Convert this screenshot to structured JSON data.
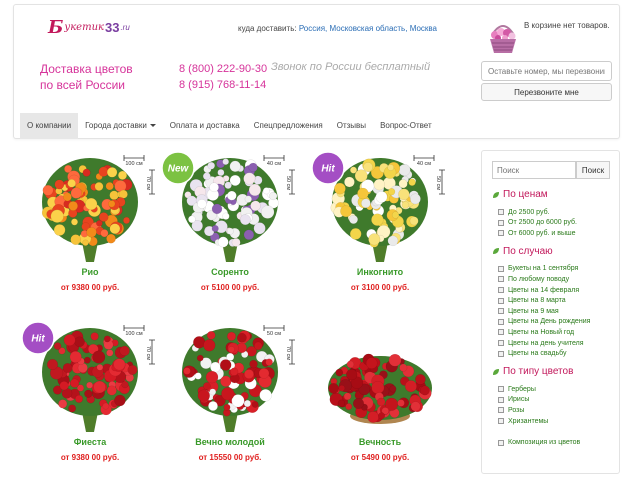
{
  "header": {
    "logo": {
      "b": "Б",
      "word": "укетик",
      "num": "33",
      "ru": ".ru"
    },
    "deliver_label": "куда доставить:",
    "locations": [
      "Россия,",
      "Московская область,",
      "Москва"
    ],
    "cart_text": "В корзине нет товаров.",
    "tagline_line1": "Доставка цветов",
    "tagline_line2": "по всей России",
    "phone1": "8 (800) 222-90-30",
    "phone2": "8 (915) 768-11-14",
    "free_call": "Звонок по России бесплатный",
    "callback_placeholder": "Оставьте номер, мы перезвоним",
    "callback_button": "Перезвоните мне"
  },
  "nav": [
    {
      "label": "О компании",
      "active": true
    },
    {
      "label": "Города доставки",
      "dropdown": true
    },
    {
      "label": "Оплата и доставка"
    },
    {
      "label": "Спецпредложения"
    },
    {
      "label": "Отзывы"
    },
    {
      "label": "Вопрос-Ответ"
    }
  ],
  "products": [
    {
      "name": "Рио",
      "price": "от 9380 00 руб.",
      "size_w": "100 см",
      "size_h": "70 см",
      "badge": ""
    },
    {
      "name": "Соренто",
      "price": "от 5100 00 руб.",
      "size_w": "40 см",
      "size_h": "50 см",
      "badge": "New"
    },
    {
      "name": "Инкогнито",
      "price": "от 3100 00 руб.",
      "size_w": "40 см",
      "size_h": "50 см",
      "badge": "Hit"
    },
    {
      "name": "Фиеста",
      "price": "от 9380 00 руб.",
      "size_w": "100 см",
      "size_h": "70 см",
      "badge": "Hit"
    },
    {
      "name": "Вечно молодой",
      "price": "от 15550 00 руб.",
      "size_w": "50 см",
      "size_h": "70 см",
      "badge": ""
    },
    {
      "name": "Вечность",
      "price": "от 5490 00 руб.",
      "size_w": "",
      "size_h": "",
      "badge": ""
    }
  ],
  "sidebar": {
    "search_placeholder": "Поиск",
    "search_button": "Поиск",
    "sections": [
      {
        "title": "По ценам",
        "items": [
          "До 2500 руб.",
          "От 2500 до 6000 руб.",
          "От 6000 руб. и выше"
        ]
      },
      {
        "title": "По случаю",
        "items": [
          "Букеты на 1 сентября",
          "По любому поводу",
          "Цветы на 14 февраля",
          "Цветы на 8 марта",
          "Цветы на 9 мая",
          "Цветы на День рождения",
          "Цветы на Новый год",
          "Цветы на день учителя",
          "Цветы на свадьбу"
        ]
      },
      {
        "title": "По типу цветов",
        "items": [
          "Герберы",
          "Ирисы",
          "Розы",
          "Хризантемы",
          "Композиция из цветов"
        ]
      }
    ]
  },
  "colors": {
    "brand_pink": "#d6339a",
    "green": "#3a9a2a",
    "price_red": "#e0201f",
    "link_blue": "#2a6db5"
  }
}
